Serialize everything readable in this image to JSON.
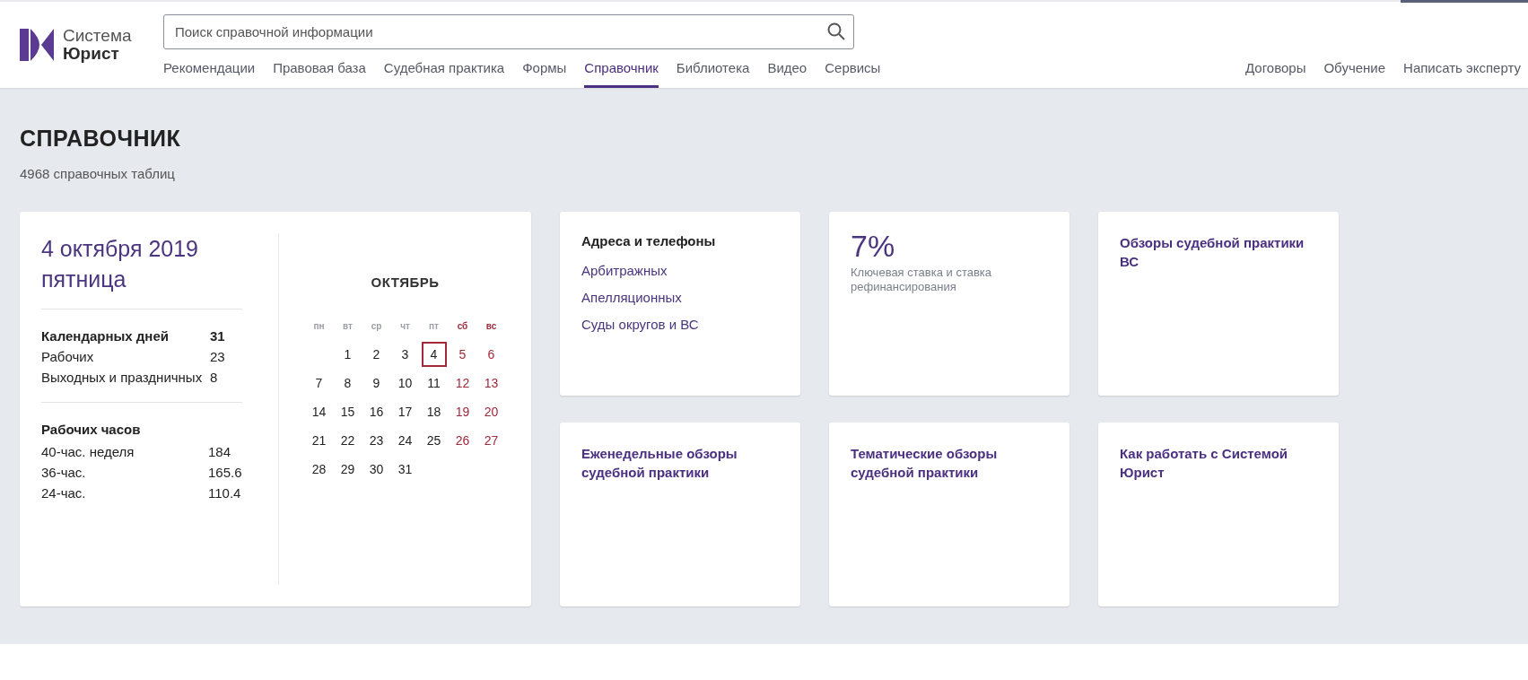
{
  "header": {
    "logo": {
      "line1": "Система",
      "line2": "Юрист"
    },
    "search": {
      "placeholder": "Поиск справочной информации"
    },
    "nav": [
      {
        "label": "Рекомендации",
        "selected": false
      },
      {
        "label": "Правовая база",
        "selected": false
      },
      {
        "label": "Судебная практика",
        "selected": false
      },
      {
        "label": "Формы",
        "selected": false
      },
      {
        "label": "Справочник",
        "selected": true
      },
      {
        "label": "Библиотека",
        "selected": false
      },
      {
        "label": "Видео",
        "selected": false
      },
      {
        "label": "Сервисы",
        "selected": false
      }
    ],
    "nav_right": [
      "Договоры",
      "Обучение",
      "Написать эксперту"
    ]
  },
  "page": {
    "title": "СПРАВОЧНИК",
    "subtitle": "4968 справочных таблиц"
  },
  "calendar_card": {
    "date": "4 октября 2019",
    "weekday": "пятница",
    "days_stats": [
      {
        "label": "Календарных дней",
        "value": "31",
        "bold": true
      },
      {
        "label": "Рабочих",
        "value": "23",
        "bold": false
      },
      {
        "label": "Выходных и праздничных",
        "value": "8",
        "bold": false
      }
    ],
    "hours_title": "Рабочих часов",
    "hours": [
      {
        "label": "40-час. неделя",
        "value": "184"
      },
      {
        "label": "36-час.",
        "value": "165.6"
      },
      {
        "label": "24-час.",
        "value": "110.4"
      }
    ],
    "month": "ОКТЯБРЬ",
    "weekdays": [
      {
        "label": "пн",
        "weekend": false
      },
      {
        "label": "вт",
        "weekend": false
      },
      {
        "label": "ср",
        "weekend": false
      },
      {
        "label": "чт",
        "weekend": false
      },
      {
        "label": "пт",
        "weekend": false
      },
      {
        "label": "сб",
        "weekend": true
      },
      {
        "label": "вс",
        "weekend": true
      }
    ],
    "weeks": [
      [
        {
          "day": "1",
          "weekend": false,
          "selected": false
        },
        {
          "day": "2",
          "weekend": false,
          "selected": false
        },
        {
          "day": "3",
          "weekend": false,
          "selected": false
        },
        {
          "day": "4",
          "weekend": false,
          "selected": true
        },
        {
          "day": "5",
          "weekend": true,
          "selected": false
        },
        {
          "day": "6",
          "weekend": true,
          "selected": false
        }
      ],
      [
        {
          "day": "7",
          "weekend": false,
          "selected": false
        },
        {
          "day": "8",
          "weekend": false,
          "selected": false
        },
        {
          "day": "9",
          "weekend": false,
          "selected": false
        },
        {
          "day": "10",
          "weekend": false,
          "selected": false
        },
        {
          "day": "11",
          "weekend": false,
          "selected": false
        },
        {
          "day": "12",
          "weekend": true,
          "selected": false
        },
        {
          "day": "13",
          "weekend": true,
          "selected": false
        }
      ],
      [
        {
          "day": "14",
          "weekend": false,
          "selected": false
        },
        {
          "day": "15",
          "weekend": false,
          "selected": false
        },
        {
          "day": "16",
          "weekend": false,
          "selected": false
        },
        {
          "day": "17",
          "weekend": false,
          "selected": false
        },
        {
          "day": "18",
          "weekend": false,
          "selected": false
        },
        {
          "day": "19",
          "weekend": true,
          "selected": false
        },
        {
          "day": "20",
          "weekend": true,
          "selected": false
        }
      ],
      [
        {
          "day": "21",
          "weekend": false,
          "selected": false
        },
        {
          "day": "22",
          "weekend": false,
          "selected": false
        },
        {
          "day": "23",
          "weekend": false,
          "selected": false
        },
        {
          "day": "24",
          "weekend": false,
          "selected": false
        },
        {
          "day": "25",
          "weekend": false,
          "selected": false
        },
        {
          "day": "26",
          "weekend": true,
          "selected": false
        },
        {
          "day": "27",
          "weekend": true,
          "selected": false
        }
      ],
      [
        {
          "day": "28",
          "weekend": false,
          "selected": false
        },
        {
          "day": "29",
          "weekend": false,
          "selected": false
        },
        {
          "day": "30",
          "weekend": false,
          "selected": false
        },
        {
          "day": "31",
          "weekend": false,
          "selected": false
        }
      ]
    ]
  },
  "cards": [
    {
      "kind": "links",
      "title": "Адреса и телефоны",
      "links": [
        "Арбитражных",
        "Апелляционных",
        "Суды округов и ВС"
      ]
    },
    {
      "kind": "rate",
      "value": "7%",
      "caption": "Ключевая ставка и ставка рефинансирования"
    },
    {
      "kind": "title",
      "title": "Обзоры судебной практики ВС"
    },
    {
      "kind": "title",
      "title": "Еженедельные обзоры судебной практики"
    },
    {
      "kind": "title",
      "title": "Тематические обзоры судебной практики"
    },
    {
      "kind": "title",
      "title": "Как работать с Системой Юрист"
    }
  ]
}
